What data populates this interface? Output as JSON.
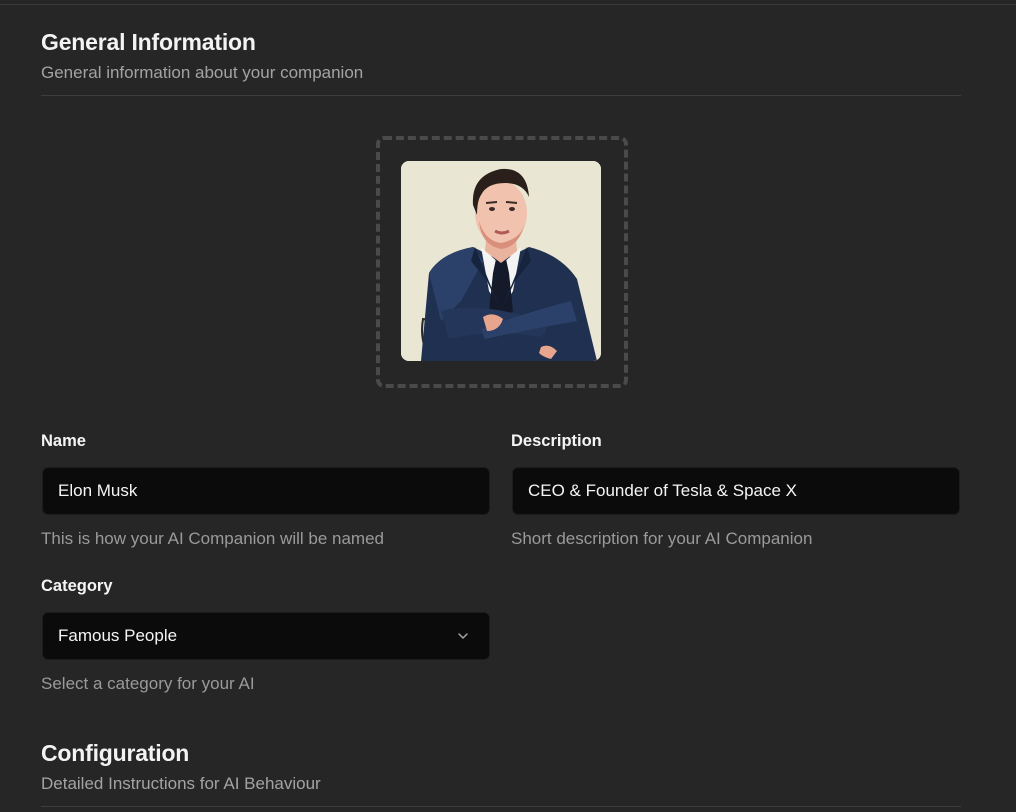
{
  "general": {
    "title": "General Information",
    "subtitle": "General information about your companion"
  },
  "avatar": {
    "image": "companion-avatar-portrait"
  },
  "fields": {
    "name": {
      "label": "Name",
      "value": "Elon Musk",
      "help": "This is how your AI Companion will be named"
    },
    "description": {
      "label": "Description",
      "value": "CEO & Founder of Tesla & Space X",
      "help": "Short description for your AI Companion"
    },
    "category": {
      "label": "Category",
      "selected": "Famous People",
      "help": "Select a category for your AI"
    }
  },
  "configuration": {
    "title": "Configuration",
    "subtitle": "Detailed Instructions for AI Behaviour"
  },
  "colors": {
    "background": "#262626",
    "input_background": "#0b0b0b",
    "muted_text": "#a3a3a3"
  }
}
